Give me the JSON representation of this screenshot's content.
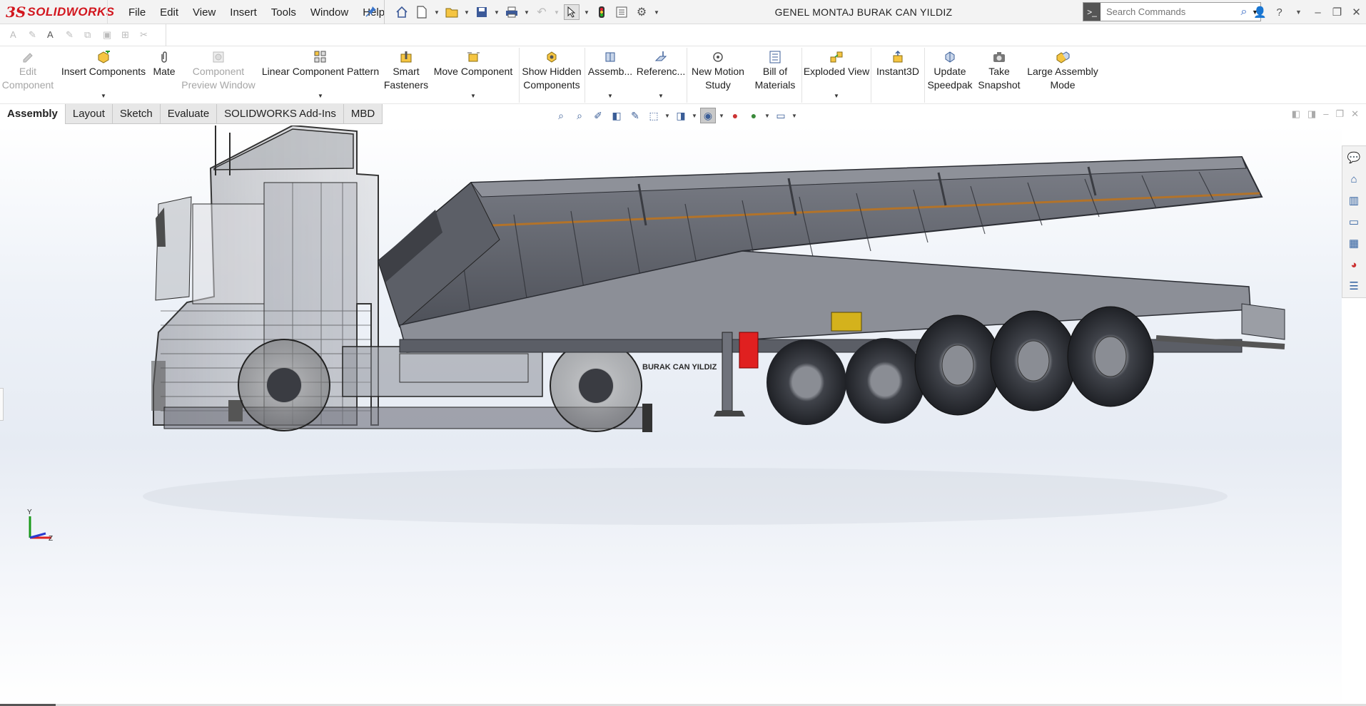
{
  "app": {
    "brand_ds": "3S",
    "brand_name": "SOLIDWORKS"
  },
  "menu": [
    "File",
    "Edit",
    "View",
    "Insert",
    "Tools",
    "Window",
    "Help"
  ],
  "document_title": "GENEL MONTAJ BURAK CAN YILDIZ",
  "search": {
    "placeholder": "Search Commands"
  },
  "command_manager": {
    "edit_component": "Edit\nComponent",
    "insert_components": "Insert Components",
    "mate": "Mate",
    "component_preview": "Component\nPreview Window",
    "linear_pattern": "Linear Component Pattern",
    "smart_fasteners": "Smart\nFasteners",
    "move_component": "Move Component",
    "show_hidden": "Show Hidden\nComponents",
    "assembly": "Assemb...",
    "reference": "Referenc...",
    "new_motion_study": "New Motion\nStudy",
    "bill_of_materials": "Bill of\nMaterials",
    "exploded_view": "Exploded View",
    "instant3d": "Instant3D",
    "update_speedpak": "Update\nSpeedpak",
    "take_snapshot": "Take\nSnapshot",
    "large_assembly_mode": "Large Assembly\nMode"
  },
  "tabs": [
    "Assembly",
    "Layout",
    "Sketch",
    "Evaluate",
    "SOLIDWORKS Add-Ins",
    "MBD"
  ],
  "active_tab": "Assembly",
  "model": {
    "trailer_lettering": "BURAK CAN YILDIZ"
  },
  "triad": {
    "y": "Y",
    "z": "Z"
  },
  "colors": {
    "brand_red": "#d2161e",
    "accent_blue": "#3b5e97",
    "model_gray": "#6f727b",
    "highlight_red": "#e02020",
    "axis_y": "#1a9a1a",
    "axis_x": "#d22",
    "axis_z": "#2a3ad0"
  }
}
